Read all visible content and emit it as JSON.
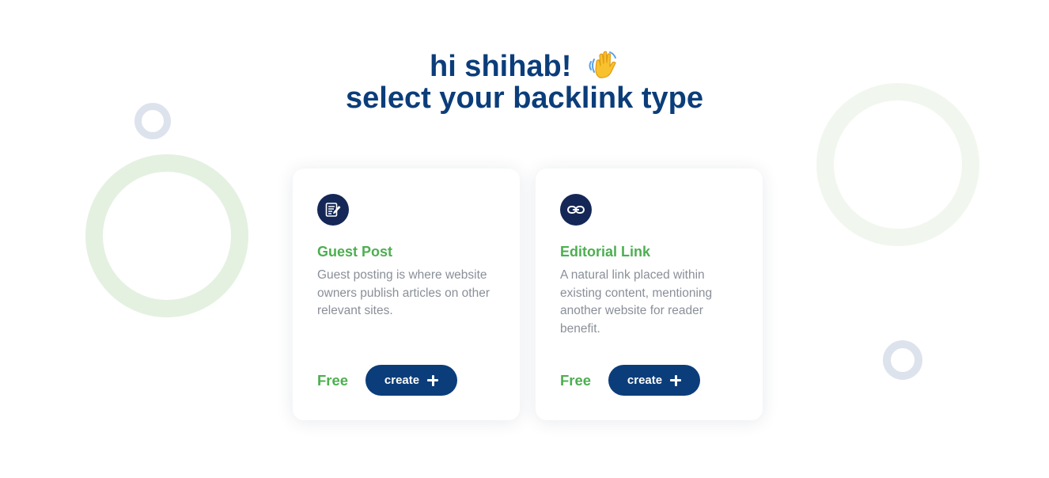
{
  "greeting": {
    "line1": "hi shihab!",
    "line2": "select your backlink type",
    "emoji_icon": "waving-hand-icon"
  },
  "cards": [
    {
      "icon": "edit-document-icon",
      "title": "Guest Post",
      "description": "Guest posting is where website owners publish articles on other relevant sites.",
      "price": "Free",
      "button_label": "create",
      "button_icon": "plus-icon"
    },
    {
      "icon": "link-icon",
      "title": "Editorial Link",
      "description": "A natural link placed within existing content, mentioning another website for reader benefit.",
      "price": "Free",
      "button_label": "create",
      "button_icon": "plus-icon"
    }
  ],
  "colors": {
    "heading": "#0b3d7a",
    "accent_green": "#4caf50",
    "button": "#0b3d7a",
    "icon_bg": "#142756",
    "description": "#8a8f98"
  }
}
